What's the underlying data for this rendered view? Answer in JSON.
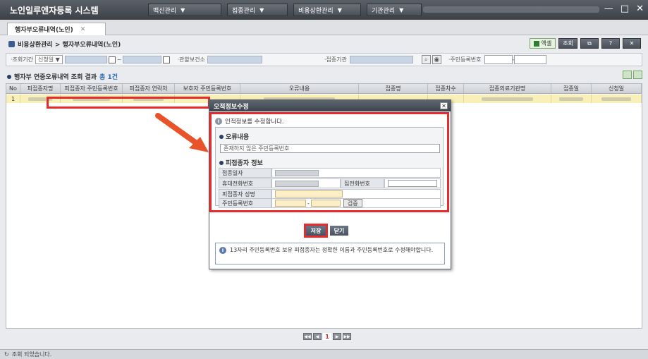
{
  "app": {
    "title": "노인일루엔자등록 시스템"
  },
  "top_menu": [
    {
      "label": "백신관리"
    },
    {
      "label": "접종관리"
    },
    {
      "label": "비용상환관리"
    },
    {
      "label": "기관관리"
    }
  ],
  "window_controls": {
    "minimize": "—",
    "maximize": "□",
    "close": "✕"
  },
  "tab": {
    "label": "행자부오류내역(노인)",
    "close": "✕"
  },
  "breadcrumb": "비용상환관리 > 행자부오류내역(노인)",
  "toolbar": {
    "excel": "엑셀",
    "search": "조회"
  },
  "search": {
    "period_label": "·조회기간",
    "period_select": "신청일",
    "range_sep": "~",
    "health_center_label": "·관할보건소",
    "institution_label": "·접종기관",
    "rrn_label": "·주민등록번호",
    "rrn_sep": "-"
  },
  "result": {
    "title": "행자부 연중오류내역 조회 결과",
    "count": "총 1건"
  },
  "grid": {
    "columns": [
      "No",
      "피접종자명",
      "피접종자 주민등록번호",
      "피접종자 연락처",
      "보호자 주민등록번호",
      "오류내용",
      "접종명",
      "접종차수",
      "접종의료기관명",
      "접종일",
      "신청일"
    ],
    "row": {
      "no": "1"
    }
  },
  "pager": {
    "first": "◀◀",
    "prev": "◀",
    "current": "1",
    "next": "▶",
    "last": "▶▶"
  },
  "status": {
    "text": "조회 되었습니다."
  },
  "dialog": {
    "title": "오적정보수정",
    "close": "✕",
    "info": "인적정보를 수정합니다.",
    "error_section": "오류내용",
    "error_value": "존재하지 않은 주민등록번호",
    "person_section": "피접종자 정보",
    "fields": {
      "date_label": "접종일자",
      "mobile_label": "휴대전화번호",
      "home_phone_label": "집전화번호",
      "name_label": "피접종자 성명",
      "rrn_label": "주민등록번호",
      "rrn_sep": "-",
      "verify": "검증"
    },
    "save": "저장",
    "cancel": "닫기",
    "notice": "13자리 주민등록번호 보유 피접종자는 정확한 이름과 주민등록번호로 수정해야합니다."
  },
  "colors": {
    "highlight": "#e52b2b",
    "row_selected": "#f8f0b8",
    "titlebar": "#3c4148"
  }
}
